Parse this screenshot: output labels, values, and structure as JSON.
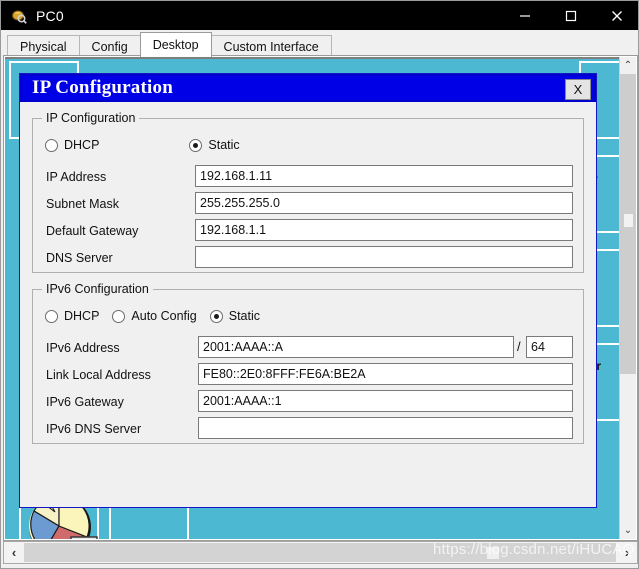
{
  "window": {
    "title": "PC0",
    "icon": "device-pc-icon",
    "minimize_label": "–",
    "maximize_label": "☐",
    "close_label": "✕"
  },
  "tabs": [
    {
      "label": "Physical",
      "active": false
    },
    {
      "label": "Config",
      "active": false
    },
    {
      "label": "Desktop",
      "active": true
    },
    {
      "label": "Custom Interface",
      "active": false
    }
  ],
  "dialog": {
    "title": "IP Configuration",
    "close_label": "X",
    "ipv4": {
      "group_title": "IP Configuration",
      "modes": [
        {
          "label": "DHCP",
          "selected": false
        },
        {
          "label": "Static",
          "selected": true
        }
      ],
      "fields": [
        {
          "label": "IP Address",
          "value": "192.168.1.11"
        },
        {
          "label": "Subnet Mask",
          "value": "255.255.255.0"
        },
        {
          "label": "Default Gateway",
          "value": "192.168.1.1"
        },
        {
          "label": "DNS Server",
          "value": ""
        }
      ]
    },
    "ipv6": {
      "group_title": "IPv6 Configuration",
      "modes": [
        {
          "label": "DHCP",
          "selected": false
        },
        {
          "label": "Auto Config",
          "selected": false
        },
        {
          "label": "Static",
          "selected": true
        }
      ],
      "address_label": "IPv6 Address",
      "address_value": "2001:AAAA::A",
      "prefix_separator": "/",
      "prefix_value": "64",
      "fields": [
        {
          "label": "Link Local Address",
          "value": "FE80::2E0:8FFF:FE6A:BE2A"
        },
        {
          "label": "IPv6 Gateway",
          "value": "2001:AAAA::1"
        },
        {
          "label": "IPv6 DNS Server",
          "value": ""
        }
      ]
    }
  },
  "desktop": {
    "background_color": "#4db8d1",
    "partial_labels": [
      {
        "text": "r"
      },
      {
        "text": "or"
      }
    ],
    "icons": [
      {
        "name": "mib-browser-pie-icon"
      }
    ]
  },
  "scrollbars": {
    "vertical": {
      "up_arrow": "⌃",
      "down_arrow": "⌄"
    },
    "horizontal": {
      "left_arrow": "‹",
      "right_arrow": "›"
    }
  },
  "watermark": {
    "text": "https://blog.csdn.net/iHUCAQ"
  },
  "colors": {
    "titlebar_bg": "#000000",
    "dialog_title_bg": "#0000e6",
    "desktop_teal": "#4db8d1",
    "panel_gray": "#f0f0f0"
  }
}
